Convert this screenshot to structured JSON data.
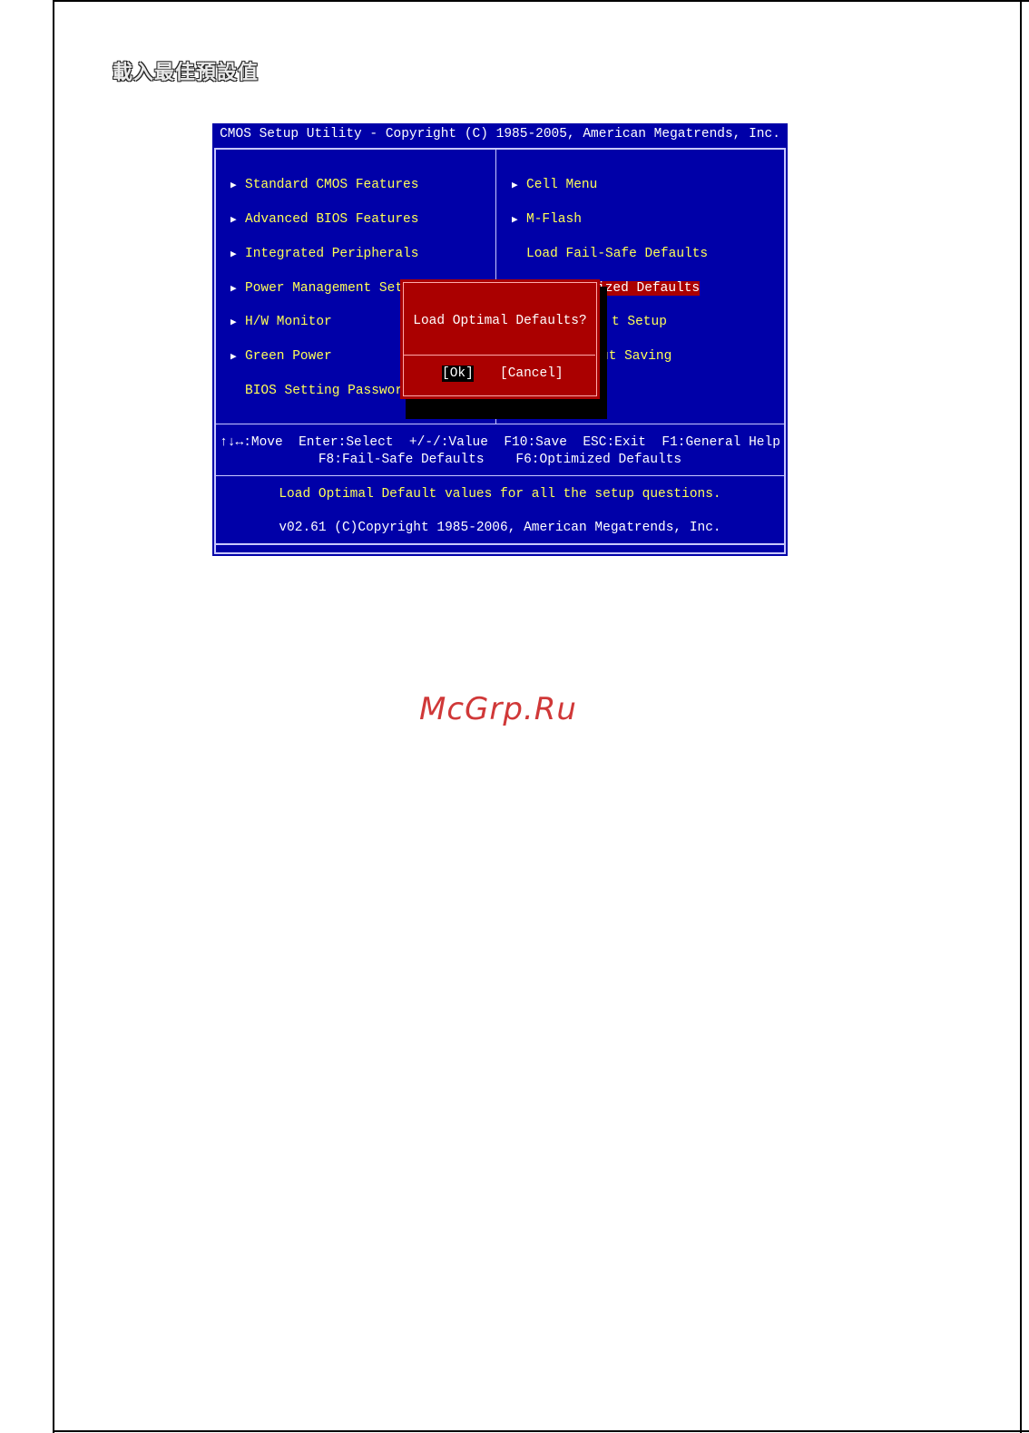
{
  "page": {
    "heading": "載入最佳預設值",
    "watermark": "McGrp.Ru"
  },
  "bios": {
    "title": "CMOS Setup Utility - Copyright (C) 1985-2005, American Megatrends, Inc.",
    "left_menu": [
      {
        "label": "Standard CMOS Features",
        "has_submenu": true
      },
      {
        "label": "Advanced BIOS Features",
        "has_submenu": true
      },
      {
        "label": "Integrated Peripherals",
        "has_submenu": true
      },
      {
        "label": "Power Management Setu",
        "has_submenu": true
      },
      {
        "label": "H/W Monitor",
        "has_submenu": true
      },
      {
        "label": "Green Power",
        "has_submenu": true
      },
      {
        "label": "BIOS Setting Password",
        "has_submenu": false
      }
    ],
    "right_menu": [
      {
        "label": "Cell Menu",
        "has_submenu": true
      },
      {
        "label": "M-Flash",
        "has_submenu": true
      },
      {
        "label": "Load Fail-Safe Defaults",
        "has_submenu": false
      },
      {
        "label": "ized Defaults",
        "has_submenu": false,
        "selected": true
      },
      {
        "label": "t Setup",
        "has_submenu": false
      },
      {
        "label": "ut Saving",
        "has_submenu": false
      }
    ],
    "help_line_1": "↑↓↔:Move  Enter:Select  +/-/:Value  F10:Save  ESC:Exit  F1:General Help",
    "help_line_2": "F8:Fail-Safe Defaults    F6:Optimized Defaults",
    "description": "Load Optimal Default values for all the setup questions.",
    "version": "v02.61 (C)Copyright 1985-2006, American Megatrends, Inc.",
    "dialog": {
      "question": "Load Optimal Defaults?",
      "ok_label": "[Ok]",
      "cancel_label": "[Cancel]"
    },
    "colors": {
      "background": "#0000a8",
      "menu_text": "#ffff55",
      "highlight": "#aa0000",
      "dialog": "#aa0000"
    }
  }
}
